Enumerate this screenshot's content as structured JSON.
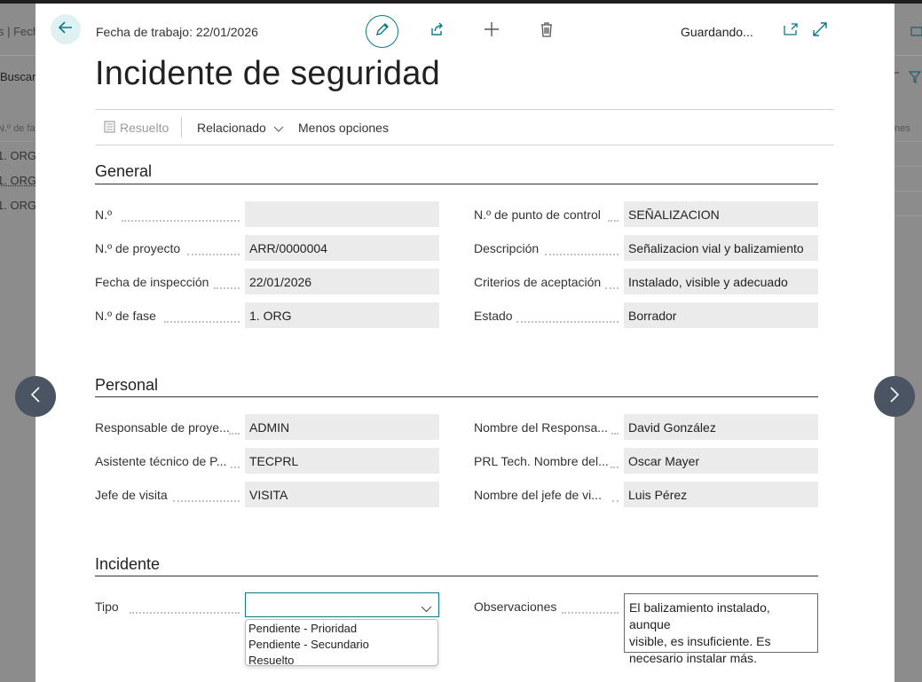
{
  "background": {
    "left_fragments": [
      "s | Fech",
      "Buscar",
      "N.º de fa",
      "1. ORG",
      "1. ORG",
      "1. ORG"
    ],
    "right_fragments": [
      "nes"
    ]
  },
  "header": {
    "work_date": "Fecha de trabajo: 22/01/2026",
    "saving_status": "Guardando..."
  },
  "page_title": "Incidente de seguridad",
  "actions": {
    "resolved": "Resuelto",
    "related": "Relacionado",
    "less_options": "Menos opciones"
  },
  "sections": {
    "general": {
      "title": "General",
      "left": [
        {
          "label": "N.º",
          "value": ""
        },
        {
          "label": "N.º de proyecto",
          "value": "ARR/0000004"
        },
        {
          "label": "Fecha de inspección",
          "value": "22/01/2026"
        },
        {
          "label": "N.º de fase",
          "value": "1. ORG"
        }
      ],
      "right": [
        {
          "label": "N.º de punto de control",
          "value": "SEÑALIZACION"
        },
        {
          "label": "Descripción",
          "value": "Señalizacion vial y balizamiento"
        },
        {
          "label": "Criterios de aceptación",
          "value": "Instalado, visible y adecuado"
        },
        {
          "label": "Estado",
          "value": "Borrador"
        }
      ]
    },
    "personal": {
      "title": "Personal",
      "left": [
        {
          "label": "Responsable de proye...",
          "value": "ADMIN"
        },
        {
          "label": "Asistente técnico de P...",
          "value": "TECPRL"
        },
        {
          "label": "Jefe de visita",
          "value": "VISITA"
        }
      ],
      "right": [
        {
          "label": "Nombre del Responsa...",
          "value": "David González"
        },
        {
          "label": "PRL Tech. Nombre del...",
          "value": "Oscar Mayer"
        },
        {
          "label": "Nombre del jefe de vi...",
          "value": "Luis Pérez"
        }
      ]
    },
    "incident": {
      "title": "Incidente",
      "type_label": "Tipo",
      "type_value": "",
      "type_options": [
        "Pendiente - Prioridad",
        "Pendiente - Secundario",
        "Resuelto"
      ],
      "observations_label": "Observaciones",
      "observations_lines": [
        "El balizamiento instalado, aunque",
        "visible, es insuficiente. Es",
        "necesario instalar más."
      ]
    }
  },
  "colors": {
    "accent": "#0a7b83",
    "nav_button": "#4a5462",
    "field_bg": "#ebebeb"
  }
}
